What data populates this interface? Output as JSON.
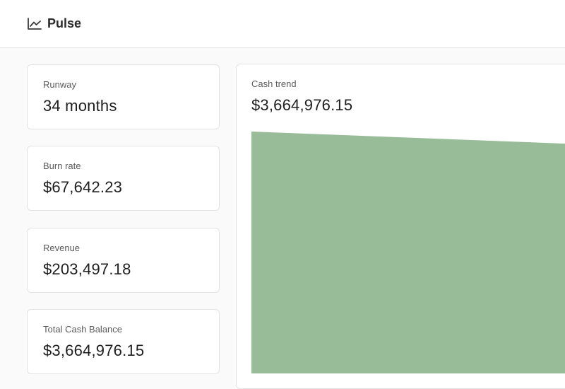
{
  "app": {
    "title": "Pulse",
    "icon": "line-chart-icon"
  },
  "metrics": [
    {
      "label": "Runway",
      "value": "34 months"
    },
    {
      "label": "Burn rate",
      "value": "$67,642.23"
    },
    {
      "label": "Revenue",
      "value": "$203,497.18"
    },
    {
      "label": "Total Cash Balance",
      "value": "$3,664,976.15"
    }
  ],
  "cash_trend": {
    "label": "Cash trend",
    "value": "$3,664,976.15",
    "fill_color": "#98bb98",
    "chart_data": {
      "type": "area",
      "series": [
        {
          "values": [
            1.0,
            0.95
          ]
        }
      ],
      "ylim": [
        0,
        1.0
      ]
    }
  },
  "colors": {
    "background": "#fafafa",
    "card": "#ffffff",
    "border": "#e3e3e3",
    "accent_green": "#98bb98"
  }
}
